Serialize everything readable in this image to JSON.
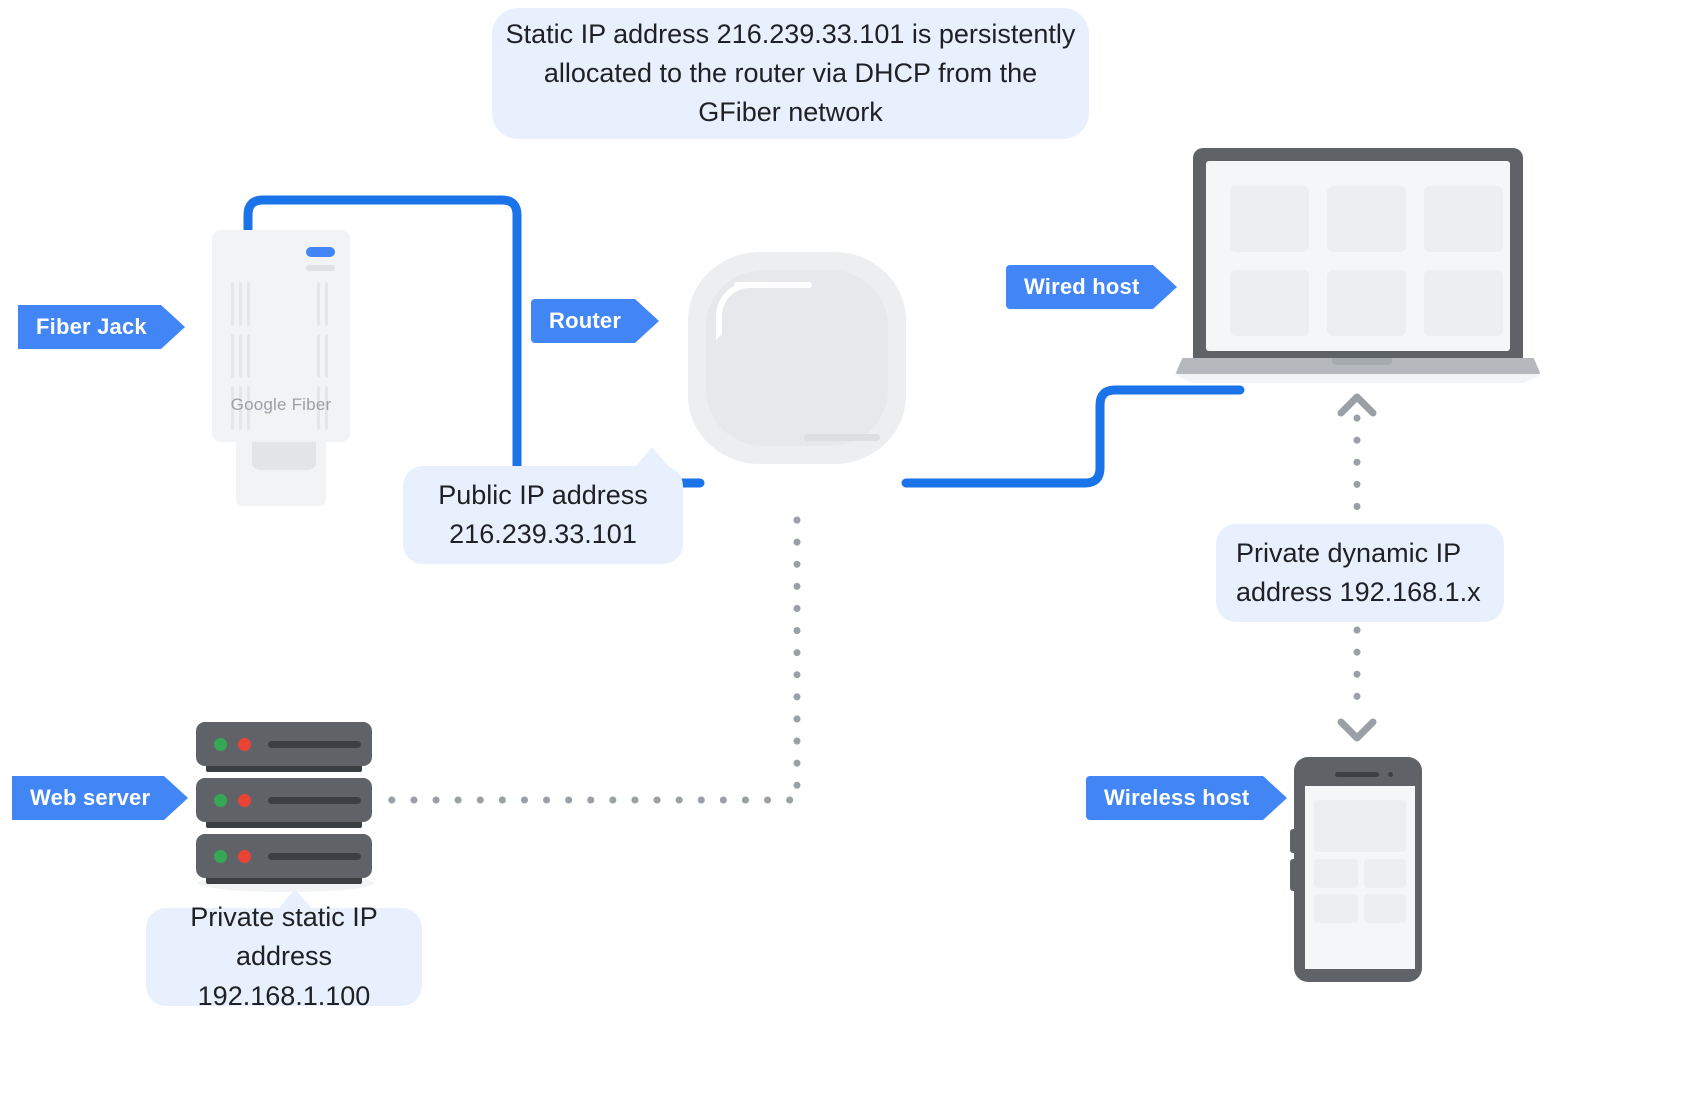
{
  "diagram": {
    "title": "GFiber network IP addressing diagram",
    "colors": {
      "tag_blue": "#4285f4",
      "cable_blue": "#1a73e8",
      "callout_bg": "#e8f0fe",
      "dotted_gray": "#9aa0a6",
      "device_dark": "#5f6368",
      "device_light": "#f1f3f4",
      "led_green": "#34a853",
      "led_red": "#ea4335"
    },
    "callouts": {
      "static_ip": {
        "id": "static-ip-callout",
        "lines": [
          "Static IP address 216.239.33.101 is persistently",
          "allocated to the router via DHCP from the",
          "GFiber network"
        ],
        "text": "Static IP address 216.239.33.101 is persistently allocated to the router via DHCP from the GFiber network"
      },
      "public_ip": {
        "id": "public-ip-callout",
        "line1": "Public IP address",
        "line2": "216.239.33.101"
      },
      "private_dynamic": {
        "id": "private-dynamic-ip-callout",
        "line1": "Private dynamic IP",
        "line2": "address 192.168.1.x"
      },
      "private_static": {
        "id": "private-static-ip-callout",
        "line1": "Private static IP",
        "line2": "address 192.168.1.100"
      }
    },
    "tags": {
      "fiber_jack": "Fiber Jack",
      "router": "Router",
      "wired_host": "Wired host",
      "web_server": "Web server",
      "wireless_host": "Wireless host"
    },
    "devices": {
      "fiber_jack": {
        "brand": "Google Fiber",
        "icon": "fiber-jack-icon"
      },
      "router": {
        "icon": "router-icon"
      },
      "laptop": {
        "icon": "laptop-icon"
      },
      "server": {
        "icon": "server-rack-icon",
        "units": 3
      },
      "phone": {
        "icon": "smartphone-icon"
      }
    },
    "connections": [
      {
        "id": "fiberjack-to-router",
        "style": "solid",
        "color": "#1a73e8"
      },
      {
        "id": "router-to-laptop",
        "style": "solid",
        "color": "#1a73e8"
      },
      {
        "id": "router-to-webserver",
        "style": "dotted",
        "color": "#9aa0a6"
      },
      {
        "id": "laptop-to-phone",
        "style": "dotted-double-arrow",
        "color": "#9aa0a6"
      }
    ]
  }
}
